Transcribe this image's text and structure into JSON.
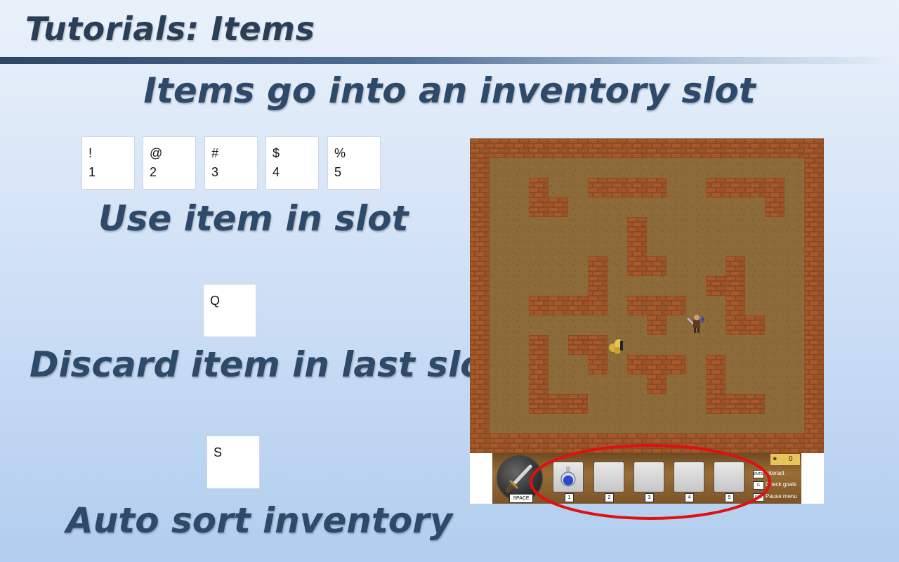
{
  "header": {
    "title": "Tutorials: Items"
  },
  "main": {
    "heading": "Items go into an inventory slot"
  },
  "use_section": {
    "keys": [
      {
        "symbol": "!",
        "number": "1"
      },
      {
        "symbol": "@",
        "number": "2"
      },
      {
        "symbol": "#",
        "number": "3"
      },
      {
        "symbol": "$",
        "number": "4"
      },
      {
        "symbol": "%",
        "number": "5"
      }
    ],
    "label": "Use item in slot"
  },
  "discard_section": {
    "key": "Q",
    "label": "Discard item in last slot"
  },
  "sort_section": {
    "key": "S",
    "label": "Auto sort inventory"
  },
  "game": {
    "attack_key": "SPACE",
    "slots": [
      {
        "number": "1",
        "item": "potion"
      },
      {
        "number": "2",
        "item": ""
      },
      {
        "number": "3",
        "item": ""
      },
      {
        "number": "4",
        "item": ""
      },
      {
        "number": "5",
        "item": ""
      }
    ],
    "gold": "0",
    "controls": [
      {
        "key": "ENTER",
        "label": "Interact"
      },
      {
        "key": "G",
        "label": "Check goals"
      },
      {
        "key": "ESC",
        "label": "Pause menu"
      }
    ],
    "colors": {
      "wall": "#8a4a22",
      "floor": "#8c6a3a",
      "highlight": "#e01010"
    }
  }
}
